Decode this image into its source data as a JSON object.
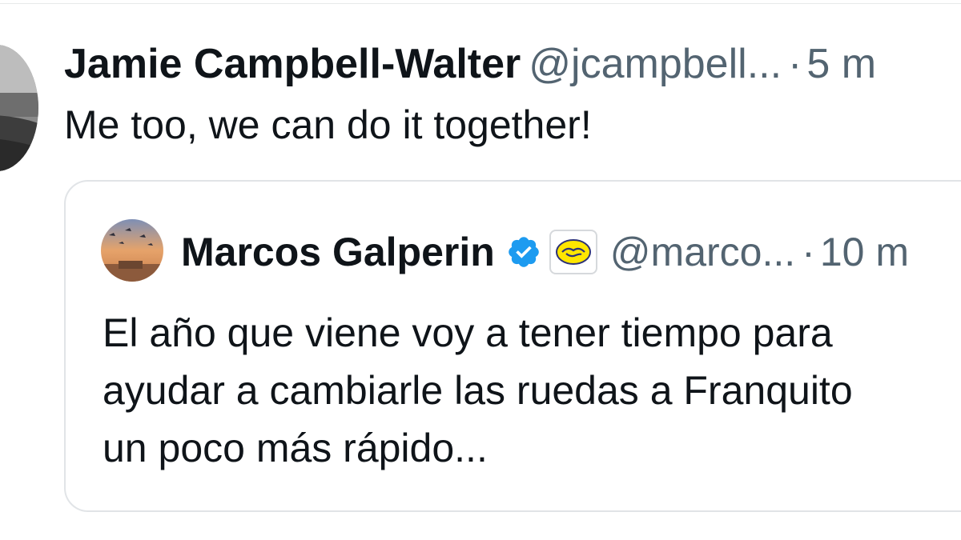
{
  "tweet": {
    "author_name": "Jamie Campbell-Walter",
    "author_handle": "@jcampbell...",
    "separator": "·",
    "time": "5 m",
    "text": "Me too, we can do it together!",
    "avatar_icon": "avatar-photo"
  },
  "quoted_tweet": {
    "author_name": "Marcos Galperin",
    "verified_icon": "verified-badge-icon",
    "affiliate_icon": "handshake-icon",
    "author_handle": "@marco...",
    "separator": "·",
    "time": "10 m",
    "text_lines": [
      "El año que viene voy a tener tiempo para",
      "ayudar a cambiarle las ruedas a Franquito",
      "un poco más rápido..."
    ]
  },
  "colors": {
    "text_primary": "#0f1419",
    "text_secondary": "#536471",
    "verified_blue": "#1d9bf0",
    "border": "#e1e4e7",
    "handshake_yellow": "#ffe600"
  }
}
